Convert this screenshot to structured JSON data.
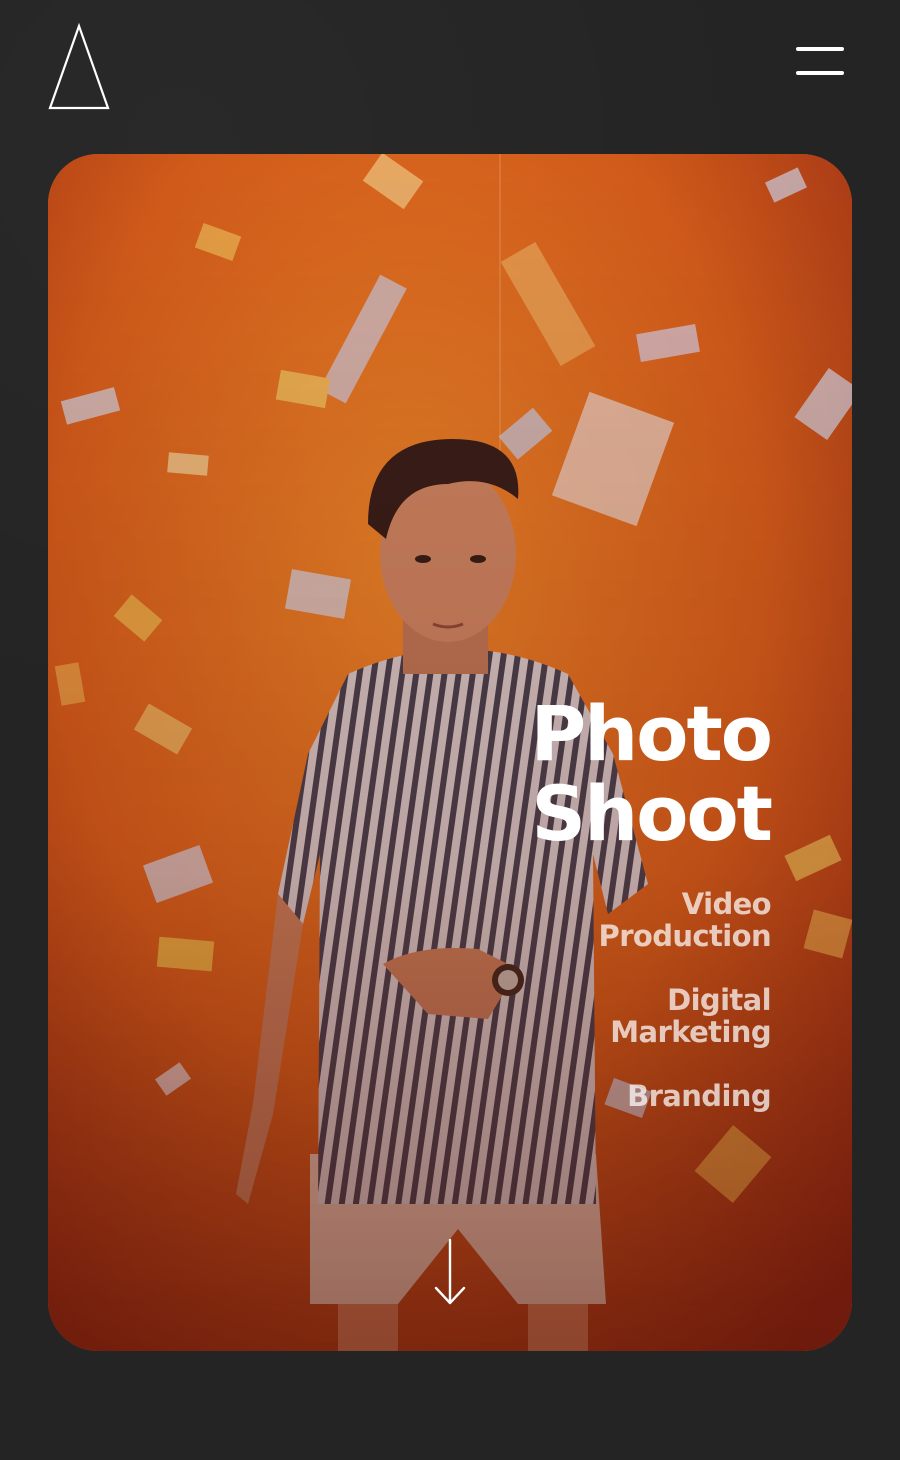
{
  "header": {
    "logo_icon": "triangle-outline-logo",
    "menu_icon": "hamburger-menu-icon"
  },
  "hero": {
    "headline": "Photo Shoot",
    "services": [
      {
        "label": "Video Production"
      },
      {
        "label": "Digital Marketing"
      },
      {
        "label": "Branding"
      }
    ],
    "scroll_icon": "arrow-down-icon"
  },
  "colors": {
    "page_background": "#242424",
    "hero_orange": "#d9601c",
    "text_primary": "#ffffff"
  }
}
